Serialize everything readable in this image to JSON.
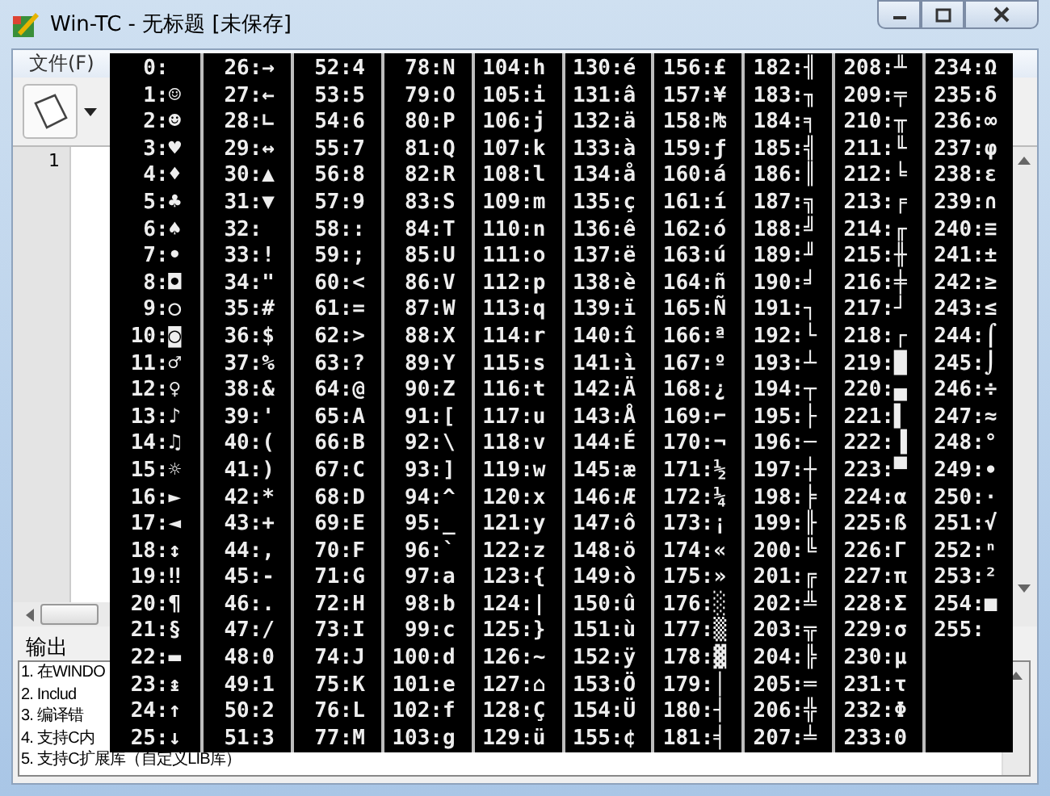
{
  "window": {
    "title": "Win-TC - 无标题 [未保存]"
  },
  "menu": [
    "文件(F)"
  ],
  "editor": {
    "line_numbers": [
      "1"
    ]
  },
  "output": {
    "label": "输出",
    "lines": [
      "1. 在WINDO",
      "2. Includ",
      "3. 编译错",
      "4. 支持C内",
      "5. 支持C扩展库（自定义LIB库）"
    ]
  },
  "console": {
    "columns": [
      [
        "0:",
        "1:☺",
        "2:☻",
        "3:♥",
        "4:♦",
        "5:♣",
        "6:♠",
        "7:•",
        "8:◘",
        "9:○",
        "10:◙",
        "11:♂",
        "12:♀",
        "13:♪",
        "14:♫",
        "15:☼",
        "16:►",
        "17:◄",
        "18:↕",
        "19:‼",
        "20:¶",
        "21:§",
        "22:▬",
        "23:↨",
        "24:↑",
        "25:↓"
      ],
      [
        "26:→",
        "27:←",
        "28:∟",
        "29:↔",
        "30:▲",
        "31:▼",
        "32:",
        "33:!",
        "34:\"",
        "35:#",
        "36:$",
        "37:%",
        "38:&",
        "39:'",
        "40:(",
        "41:)",
        "42:*",
        "43:+",
        "44:,",
        "45:-",
        "46:.",
        "47:/",
        "48:0",
        "49:1",
        "50:2",
        "51:3"
      ],
      [
        "52:4",
        "53:5",
        "54:6",
        "55:7",
        "56:8",
        "57:9",
        "58::",
        "59:;",
        "60:<",
        "61:=",
        "62:>",
        "63:?",
        "64:@",
        "65:A",
        "66:B",
        "67:C",
        "68:D",
        "69:E",
        "70:F",
        "71:G",
        "72:H",
        "73:I",
        "74:J",
        "75:K",
        "76:L",
        "77:M"
      ],
      [
        "78:N",
        "79:O",
        "80:P",
        "81:Q",
        "82:R",
        "83:S",
        "84:T",
        "85:U",
        "86:V",
        "87:W",
        "88:X",
        "89:Y",
        "90:Z",
        "91:[",
        "92:\\",
        "93:]",
        "94:^",
        "95:_",
        "96:`",
        "97:a",
        "98:b",
        "99:c",
        "100:d",
        "101:e",
        "102:f",
        "103:g"
      ],
      [
        "104:h",
        "105:i",
        "106:j",
        "107:k",
        "108:l",
        "109:m",
        "110:n",
        "111:o",
        "112:p",
        "113:q",
        "114:r",
        "115:s",
        "116:t",
        "117:u",
        "118:v",
        "119:w",
        "120:x",
        "121:y",
        "122:z",
        "123:{",
        "124:|",
        "125:}",
        "126:~",
        "127:⌂",
        "128:Ç",
        "129:ü"
      ],
      [
        "130:é",
        "131:â",
        "132:ä",
        "133:à",
        "134:å",
        "135:ç",
        "136:ê",
        "137:ë",
        "138:è",
        "139:ï",
        "140:î",
        "141:ì",
        "142:Ä",
        "143:Å",
        "144:É",
        "145:æ",
        "146:Æ",
        "147:ô",
        "148:ö",
        "149:ò",
        "150:û",
        "151:ù",
        "152:ÿ",
        "153:Ö",
        "154:Ü",
        "155:¢"
      ],
      [
        "156:£",
        "157:¥",
        "158:₧",
        "159:ƒ",
        "160:á",
        "161:í",
        "162:ó",
        "163:ú",
        "164:ñ",
        "165:Ñ",
        "166:ª",
        "167:º",
        "168:¿",
        "169:⌐",
        "170:¬",
        "171:½",
        "172:¼",
        "173:¡",
        "174:«",
        "175:»",
        "176:░",
        "177:▒",
        "178:▓",
        "179:│",
        "180:┤",
        "181:╡"
      ],
      [
        "182:╢",
        "183:╖",
        "184:╕",
        "185:╣",
        "186:║",
        "187:╗",
        "188:╝",
        "189:╜",
        "190:╛",
        "191:┐",
        "192:└",
        "193:┴",
        "194:┬",
        "195:├",
        "196:─",
        "197:┼",
        "198:╞",
        "199:╟",
        "200:╚",
        "201:╔",
        "202:╩",
        "203:╦",
        "204:╠",
        "205:═",
        "206:╬",
        "207:╧"
      ],
      [
        "208:╨",
        "209:╤",
        "210:╥",
        "211:╙",
        "212:╘",
        "213:╒",
        "214:╓",
        "215:╫",
        "216:╪",
        "217:┘",
        "218:┌",
        "219:█",
        "220:▄",
        "221:▌",
        "222:▐",
        "223:▀",
        "224:α",
        "225:ß",
        "226:Γ",
        "227:π",
        "228:Σ",
        "229:σ",
        "230:µ",
        "231:τ",
        "232:Φ",
        "233:Θ"
      ],
      [
        "234:Ω",
        "235:δ",
        "236:∞",
        "237:φ",
        "238:ε",
        "239:∩",
        "240:≡",
        "241:±",
        "242:≥",
        "243:≤",
        "244:⌠",
        "245:⌡",
        "246:÷",
        "247:≈",
        "248:°",
        "249:∙",
        "250:·",
        "251:√",
        "252:ⁿ",
        "253:²",
        "254:■",
        "255:"
      ]
    ]
  }
}
